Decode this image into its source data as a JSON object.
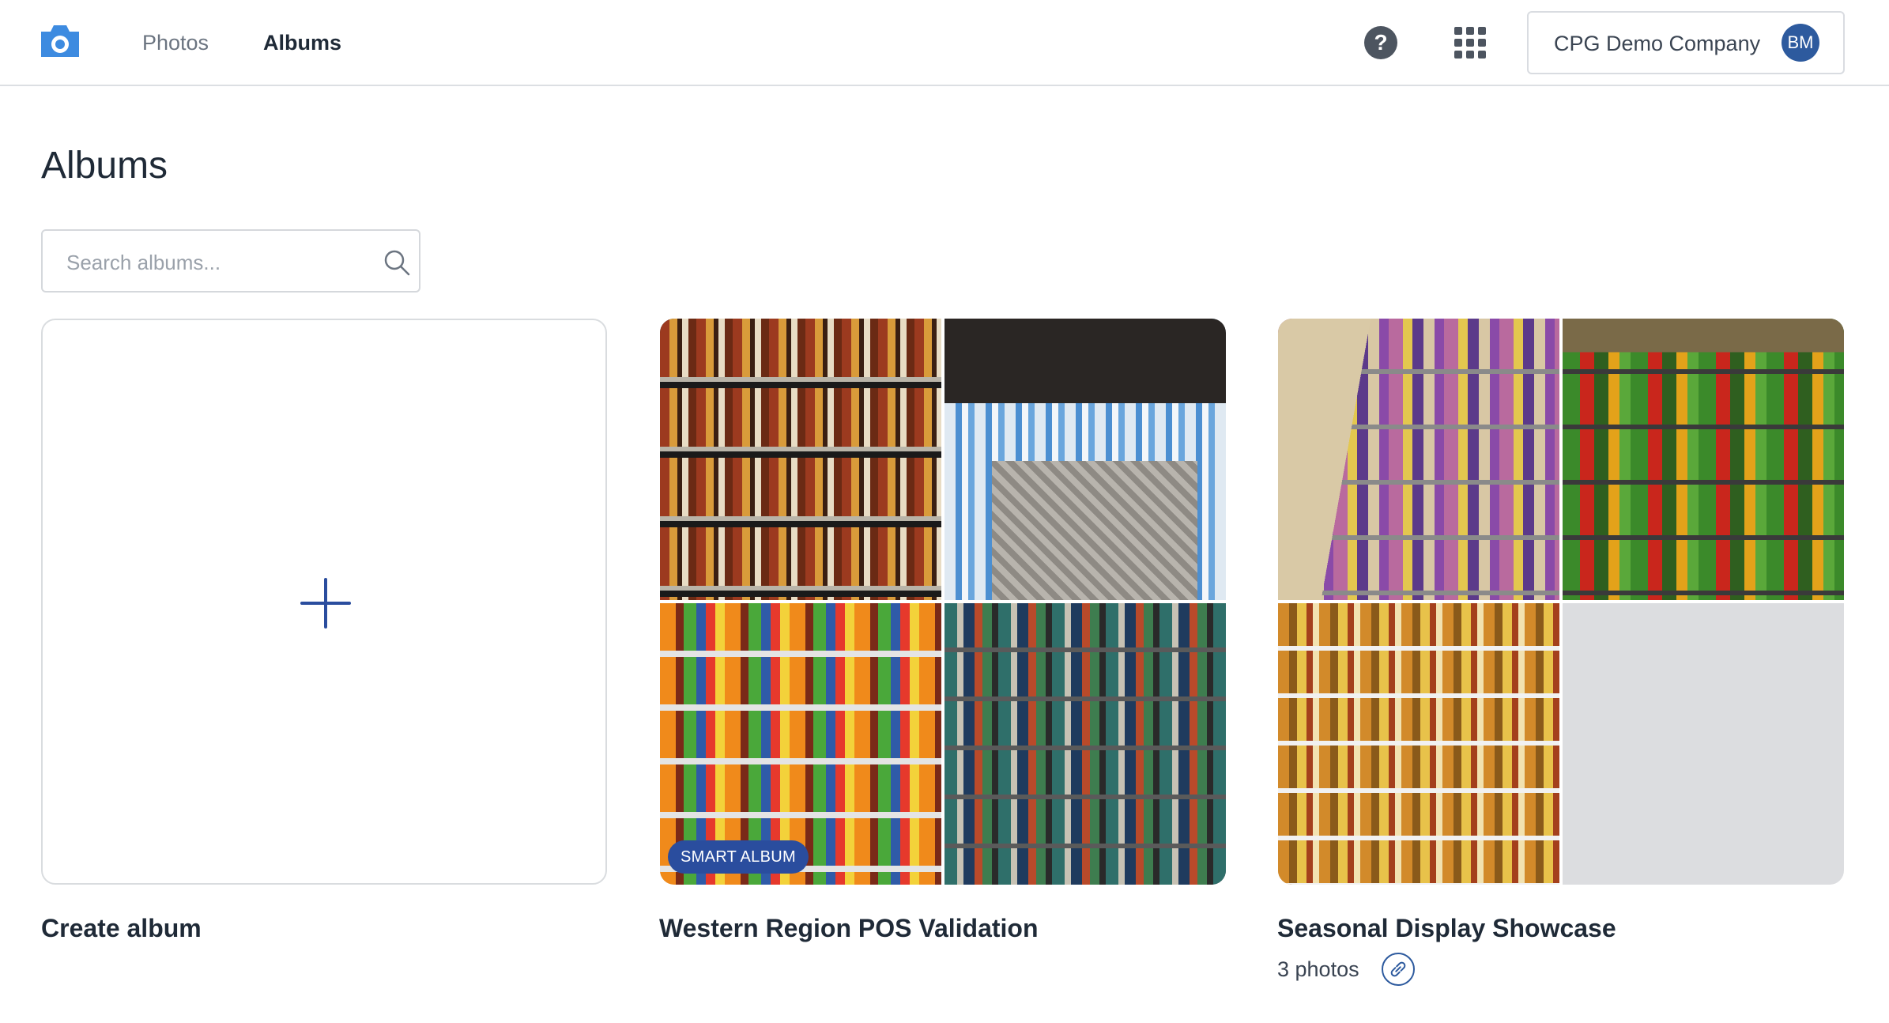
{
  "header": {
    "logo_icon": "camera-icon",
    "nav": [
      {
        "label": "Photos",
        "active": false
      },
      {
        "label": "Albums",
        "active": true
      }
    ],
    "help_icon": "help-icon",
    "help_glyph": "?",
    "apps_icon": "apps-grid-icon",
    "company": {
      "name": "CPG Demo Company",
      "avatar_initials": "BM"
    }
  },
  "page": {
    "title": "Albums"
  },
  "search": {
    "placeholder": "Search albums..."
  },
  "create_card": {
    "label": "Create album",
    "icon": "plus-icon"
  },
  "albums": [
    {
      "title": "Western Region POS Validation",
      "badge": "SMART ALBUM",
      "photo_count_text": ""
    },
    {
      "title": "Seasonal Display Showcase",
      "badge": "",
      "photo_count_text": "3 photos",
      "shared_icon": "link-icon"
    }
  ],
  "colors": {
    "accent": "#2a4d9e",
    "avatar": "#2d5a9e",
    "logo": "#3d8be0"
  }
}
